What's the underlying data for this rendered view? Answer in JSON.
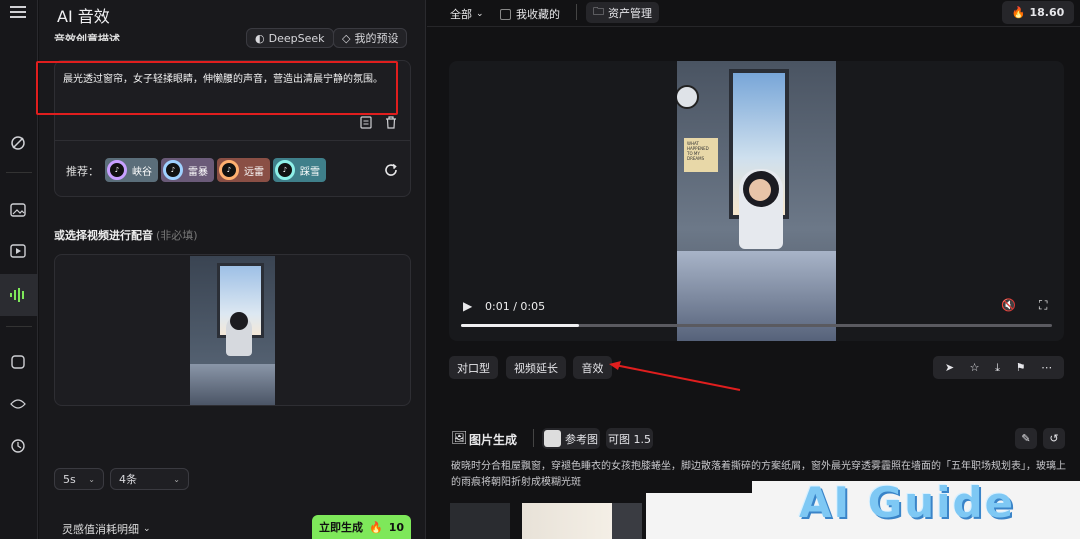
{
  "app": {
    "title": "AI 音效",
    "menu_icon": "menu-icon"
  },
  "left": {
    "desc_label": "音效创意描述",
    "deepseek_label": "DeepSeek",
    "preset_label": "我的预设",
    "prompt_text": "晨光透过窗帘，女子轻揉眼睛，伸懒腰的声音，营造出清晨宁静的氛围。",
    "recommend_label": "推荐：",
    "recommend_chips": [
      {
        "label": "峡谷",
        "color": "#5b6e7a"
      },
      {
        "label": "雷暴",
        "color": "#6a5a78"
      },
      {
        "label": "远雷",
        "color": "#8a4f45"
      },
      {
        "label": "踩雪",
        "color": "#3f7f8a"
      }
    ],
    "video_section_label": "或选择视频进行配音",
    "video_section_hint": "(非必填)",
    "duration_select": "5s",
    "count_select": "4条",
    "cost_detail_label": "灵感值消耗明细",
    "generate_label": "立即生成",
    "generate_cost": "10",
    "accent": "#7ee85a"
  },
  "right": {
    "filter_all": "全部",
    "favorites_label": "我收藏的",
    "assets_label": "资产管理",
    "credits": "18.60",
    "player": {
      "time": "0:01 / 0:05",
      "progress": 0.2
    },
    "action_buttons": [
      "对口型",
      "视频延长",
      "音效"
    ],
    "image_gen_title": "图片生成",
    "ref_image_label": "参考图",
    "model_label": "可图 1.5",
    "image_prompt": "破晓时分合租屋飘窗，穿褪色睡衣的女孩抱膝蜷坐，脚边散落着撕碎的方案纸屑，窗外晨光穿透雾霾照在墙面的「五年职场规划表」，玻璃上的雨痕将朝阳折射成模糊光斑",
    "poster_text": "WHAT HAPPENED TO MY DREAMS",
    "watermark": "AI Guide"
  }
}
